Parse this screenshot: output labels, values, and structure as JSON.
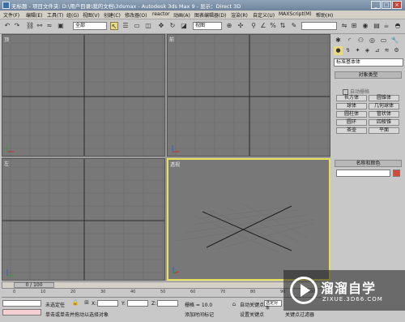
{
  "window": {
    "title": "无标题 - 项目文件夹: D:\\用户目录\\我的文档\\3dsmax - Autodesk 3ds Max 9 - 显示：Direct 3D",
    "minimize": "_",
    "maximize": "□",
    "close": "×"
  },
  "menu": [
    "文件(F)",
    "编辑(E)",
    "工具(T)",
    "组(G)",
    "视图(V)",
    "创建(C)",
    "修改器(O)",
    "reactor",
    "动画(A)",
    "图表编辑器(D)",
    "渲染(R)",
    "自定义(U)",
    "MAXScript(M)",
    "帮助(H)"
  ],
  "toolbar": {
    "selection_filter": "全部",
    "ref_coord": "视图",
    "named_sel": ""
  },
  "viewports": [
    {
      "label": "顶"
    },
    {
      "label": "前"
    },
    {
      "label": "左"
    },
    {
      "label": "透视"
    }
  ],
  "command_panel": {
    "category": "标准基本体",
    "object_type_header": "对象类型",
    "autogrid": "自动栅格",
    "buttons": [
      "长方体",
      "圆锥体",
      "球体",
      "几何球体",
      "圆柱体",
      "管状体",
      "圆环",
      "四棱锥",
      "茶壶",
      "平面"
    ],
    "name_color_header": "名称和颜色",
    "object_color": "#d24a3a"
  },
  "timeline": {
    "frame": "0 / 100",
    "ticks": [
      "0",
      "10",
      "20",
      "30",
      "40",
      "50",
      "60",
      "70",
      "80",
      "90",
      "100"
    ]
  },
  "status": {
    "selection": "未选定任",
    "x_label": "X:",
    "y_label": "Y:",
    "z_label": "Z:",
    "grid": "栅格 = 10.0",
    "prompt": "单击或单击并拖动以选择对象",
    "add_time_tag": "添加时间标记",
    "auto_key": "自动关键点",
    "set_key": "设置关键点",
    "selected_obj": "选定对象",
    "key_filters": "关键点过滤器"
  },
  "watermark": {
    "brand": "溜溜自学",
    "site": "ZIXUE.3D66.COM"
  }
}
